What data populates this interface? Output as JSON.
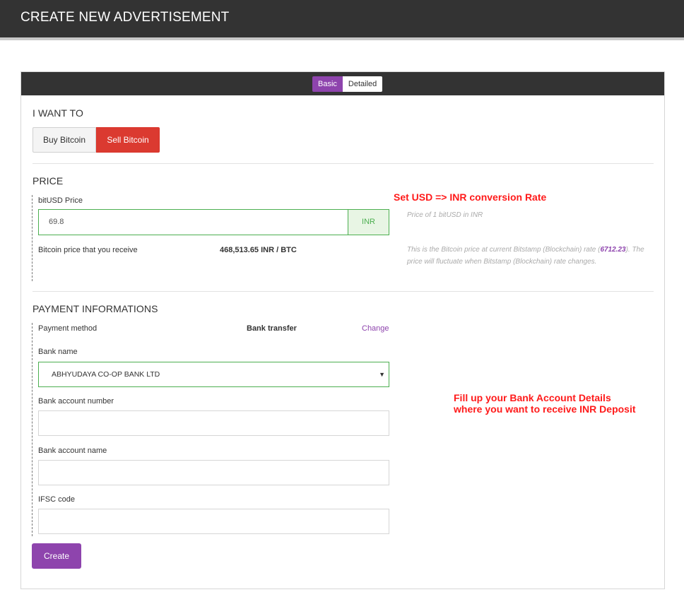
{
  "page": {
    "title": "CREATE NEW ADVERTISEMENT"
  },
  "mode_toggle": {
    "basic_label": "Basic",
    "detailed_label": "Detailed",
    "selected": "Basic"
  },
  "i_want_to": {
    "heading": "I WANT TO",
    "buy_label": "Buy Bitcoin",
    "sell_label": "Sell Bitcoin",
    "selected": "Sell Bitcoin"
  },
  "price": {
    "heading": "PRICE",
    "bitusd_label": "bitUSD Price",
    "bitusd_value": "69.8",
    "currency_addon": "INR",
    "bitusd_help": "Price of 1 bitUSD in INR",
    "receive_label": "Bitcoin price that you receive",
    "receive_value": "468,513.65 INR / BTC",
    "rate_help_prefix": "This is the Bitcoin price at current Bitstamp (Blockchain) rate (",
    "rate_value": "6712.23",
    "rate_help_suffix": "). The price will fluctuate when Bitstamp (Blockchain) rate changes."
  },
  "payment": {
    "heading": "PAYMENT INFORMATIONS",
    "method_label": "Payment method",
    "method_value": "Bank transfer",
    "change_label": "Change",
    "bank_name_label": "Bank name",
    "bank_name_value": "ABHYUDAYA CO-OP BANK LTD",
    "account_number_label": "Bank account number",
    "account_number_value": "",
    "account_name_label": "Bank account name",
    "account_name_value": "",
    "ifsc_label": "IFSC code",
    "ifsc_value": ""
  },
  "create_label": "Create",
  "annotations": {
    "conversion_note": "Set USD => INR conversion Rate",
    "bank_note_line1": "Fill up your Bank Account Details",
    "bank_note_line2": "where you want to receive INR Deposit"
  },
  "colors": {
    "accent_purple": "#8e44ad",
    "sell_red": "#db3a30",
    "valid_green": "#4caf50",
    "annotation_red": "#ff1a1a",
    "topbar_dark": "#333333"
  },
  "icons": {
    "select_caret": "caret-down-icon"
  }
}
